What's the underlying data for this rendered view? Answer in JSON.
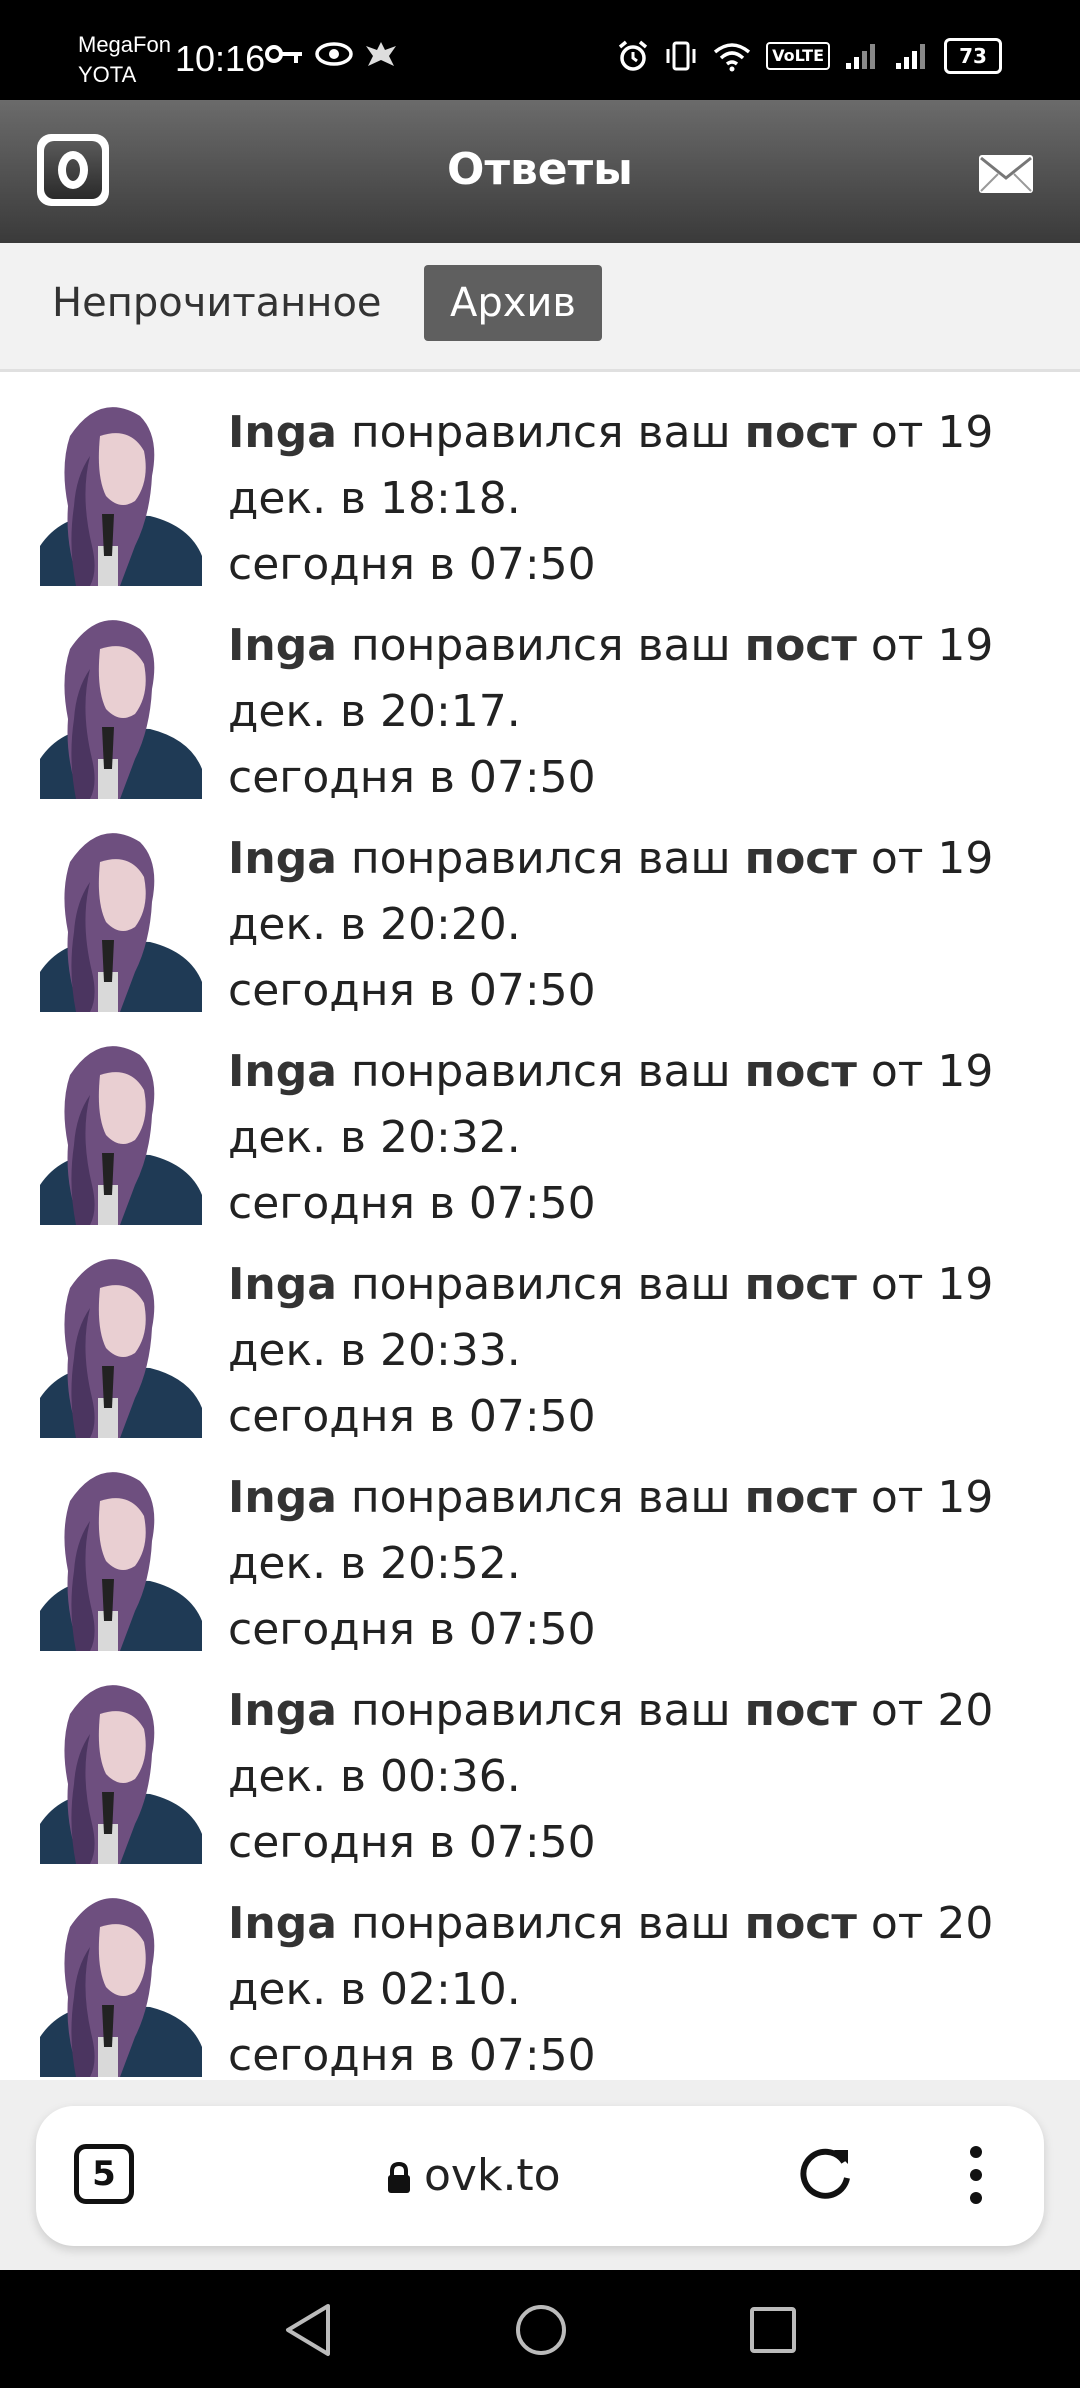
{
  "status_bar": {
    "carrier_1": "MegaFon",
    "carrier_2": "YOTA",
    "time": "10:16",
    "volte": "VoLTE",
    "battery": "73"
  },
  "header": {
    "title": "Ответы",
    "logo_icon": "openvk-logo-icon",
    "mail_icon": "mail-icon"
  },
  "tabs": [
    {
      "label": "Непрочитанное",
      "active": false
    },
    {
      "label": "Архив",
      "active": true
    }
  ],
  "notifications": [
    {
      "user": "Inga",
      "verb": " понравился ваш ",
      "object": "пост",
      "date_text": " от 19 дек. в 18:18.",
      "time": "сегодня в 07:50"
    },
    {
      "user": "Inga",
      "verb": " понравился ваш ",
      "object": "пост",
      "date_text": " от 19 дек. в 20:17.",
      "time": "сегодня в 07:50"
    },
    {
      "user": "Inga",
      "verb": " понравился ваш ",
      "object": "пост",
      "date_text": " от 19 дек. в 20:20.",
      "time": "сегодня в 07:50"
    },
    {
      "user": "Inga",
      "verb": " понравился ваш ",
      "object": "пост",
      "date_text": " от 19 дек. в 20:32.",
      "time": "сегодня в 07:50"
    },
    {
      "user": "Inga",
      "verb": " понравился ваш ",
      "object": "пост",
      "date_text": " от 19 дек. в 20:33.",
      "time": "сегодня в 07:50"
    },
    {
      "user": "Inga",
      "verb": " понравился ваш ",
      "object": "пост",
      "date_text": " от 19 дек. в 20:52.",
      "time": "сегодня в 07:50"
    },
    {
      "user": "Inga",
      "verb": " понравился ваш ",
      "object": "пост",
      "date_text": " от 20 дек. в 00:36.",
      "time": "сегодня в 07:50"
    },
    {
      "user": "Inga",
      "verb": " понравился ваш ",
      "object": "пост",
      "date_text": " от 20 дек. в 02:10.",
      "time": "сегодня в 07:50"
    }
  ],
  "browser": {
    "tab_count": "5",
    "url": "ovk.to"
  },
  "colors": {
    "header_top": "#6b6b6b",
    "header_bottom": "#3a3a3a",
    "active_tab": "#5f5f5f",
    "tabs_bg": "#f2f2f2"
  }
}
